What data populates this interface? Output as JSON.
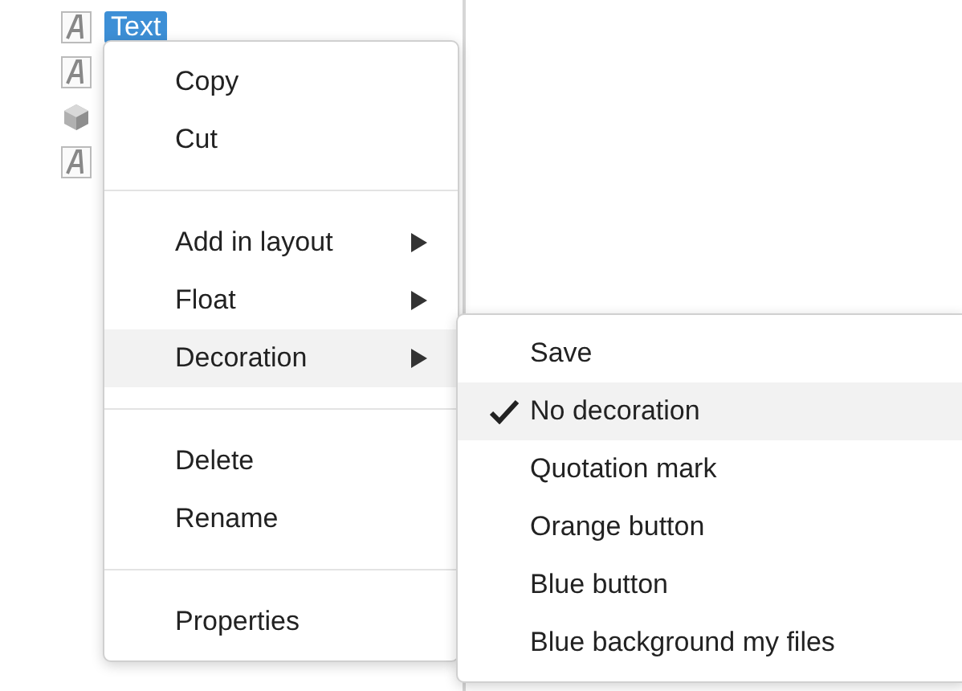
{
  "tree": {
    "items": [
      {
        "kind": "text",
        "label": "Text",
        "selected": true
      },
      {
        "kind": "text",
        "selected": false
      },
      {
        "kind": "box",
        "selected": false
      },
      {
        "kind": "text",
        "selected": false
      }
    ]
  },
  "context_menu": {
    "groups": [
      [
        {
          "label": "Copy",
          "submenu": false
        },
        {
          "label": "Cut",
          "submenu": false
        }
      ],
      [
        {
          "label": "Add in layout",
          "submenu": true,
          "selected": false
        },
        {
          "label": "Float",
          "submenu": true,
          "selected": false
        },
        {
          "label": "Decoration",
          "submenu": true,
          "selected": true
        }
      ],
      [
        {
          "label": "Delete",
          "submenu": false
        },
        {
          "label": "Rename",
          "submenu": false
        }
      ],
      [
        {
          "label": "Properties",
          "submenu": false
        }
      ]
    ]
  },
  "submenu": {
    "items": [
      {
        "label": "Save",
        "checked": false
      },
      {
        "label": "No decoration",
        "checked": true
      },
      {
        "label": "Quotation mark",
        "checked": false
      },
      {
        "label": "Orange button",
        "checked": false
      },
      {
        "label": "Blue button",
        "checked": false
      },
      {
        "label": "Blue background my files",
        "checked": false
      }
    ]
  }
}
